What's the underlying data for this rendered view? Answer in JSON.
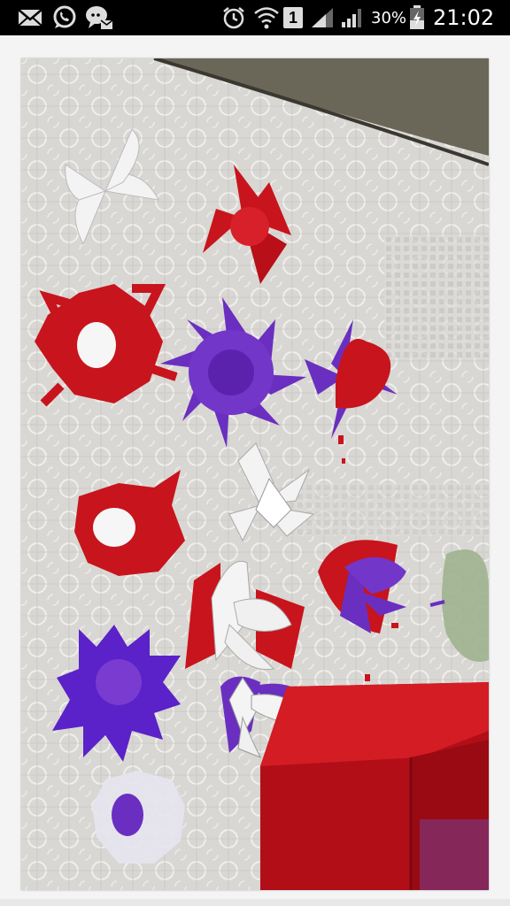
{
  "status_bar": {
    "time": "21:02",
    "battery_percent": "30%",
    "sim_slot": "1",
    "icons": [
      "mail-icon",
      "whatsapp-icon",
      "chat-icon",
      "alarm-icon",
      "wifi-icon",
      "sim-icon",
      "signal-icon",
      "signal-icon-2",
      "battery-icon"
    ]
  },
  "photo": {
    "subject": "paper-flowers-photo",
    "colors": {
      "red": "#c8141c",
      "purple": "#6a2fc0",
      "white": "#f4f4f4",
      "cloth": "#d8d6d2"
    }
  }
}
